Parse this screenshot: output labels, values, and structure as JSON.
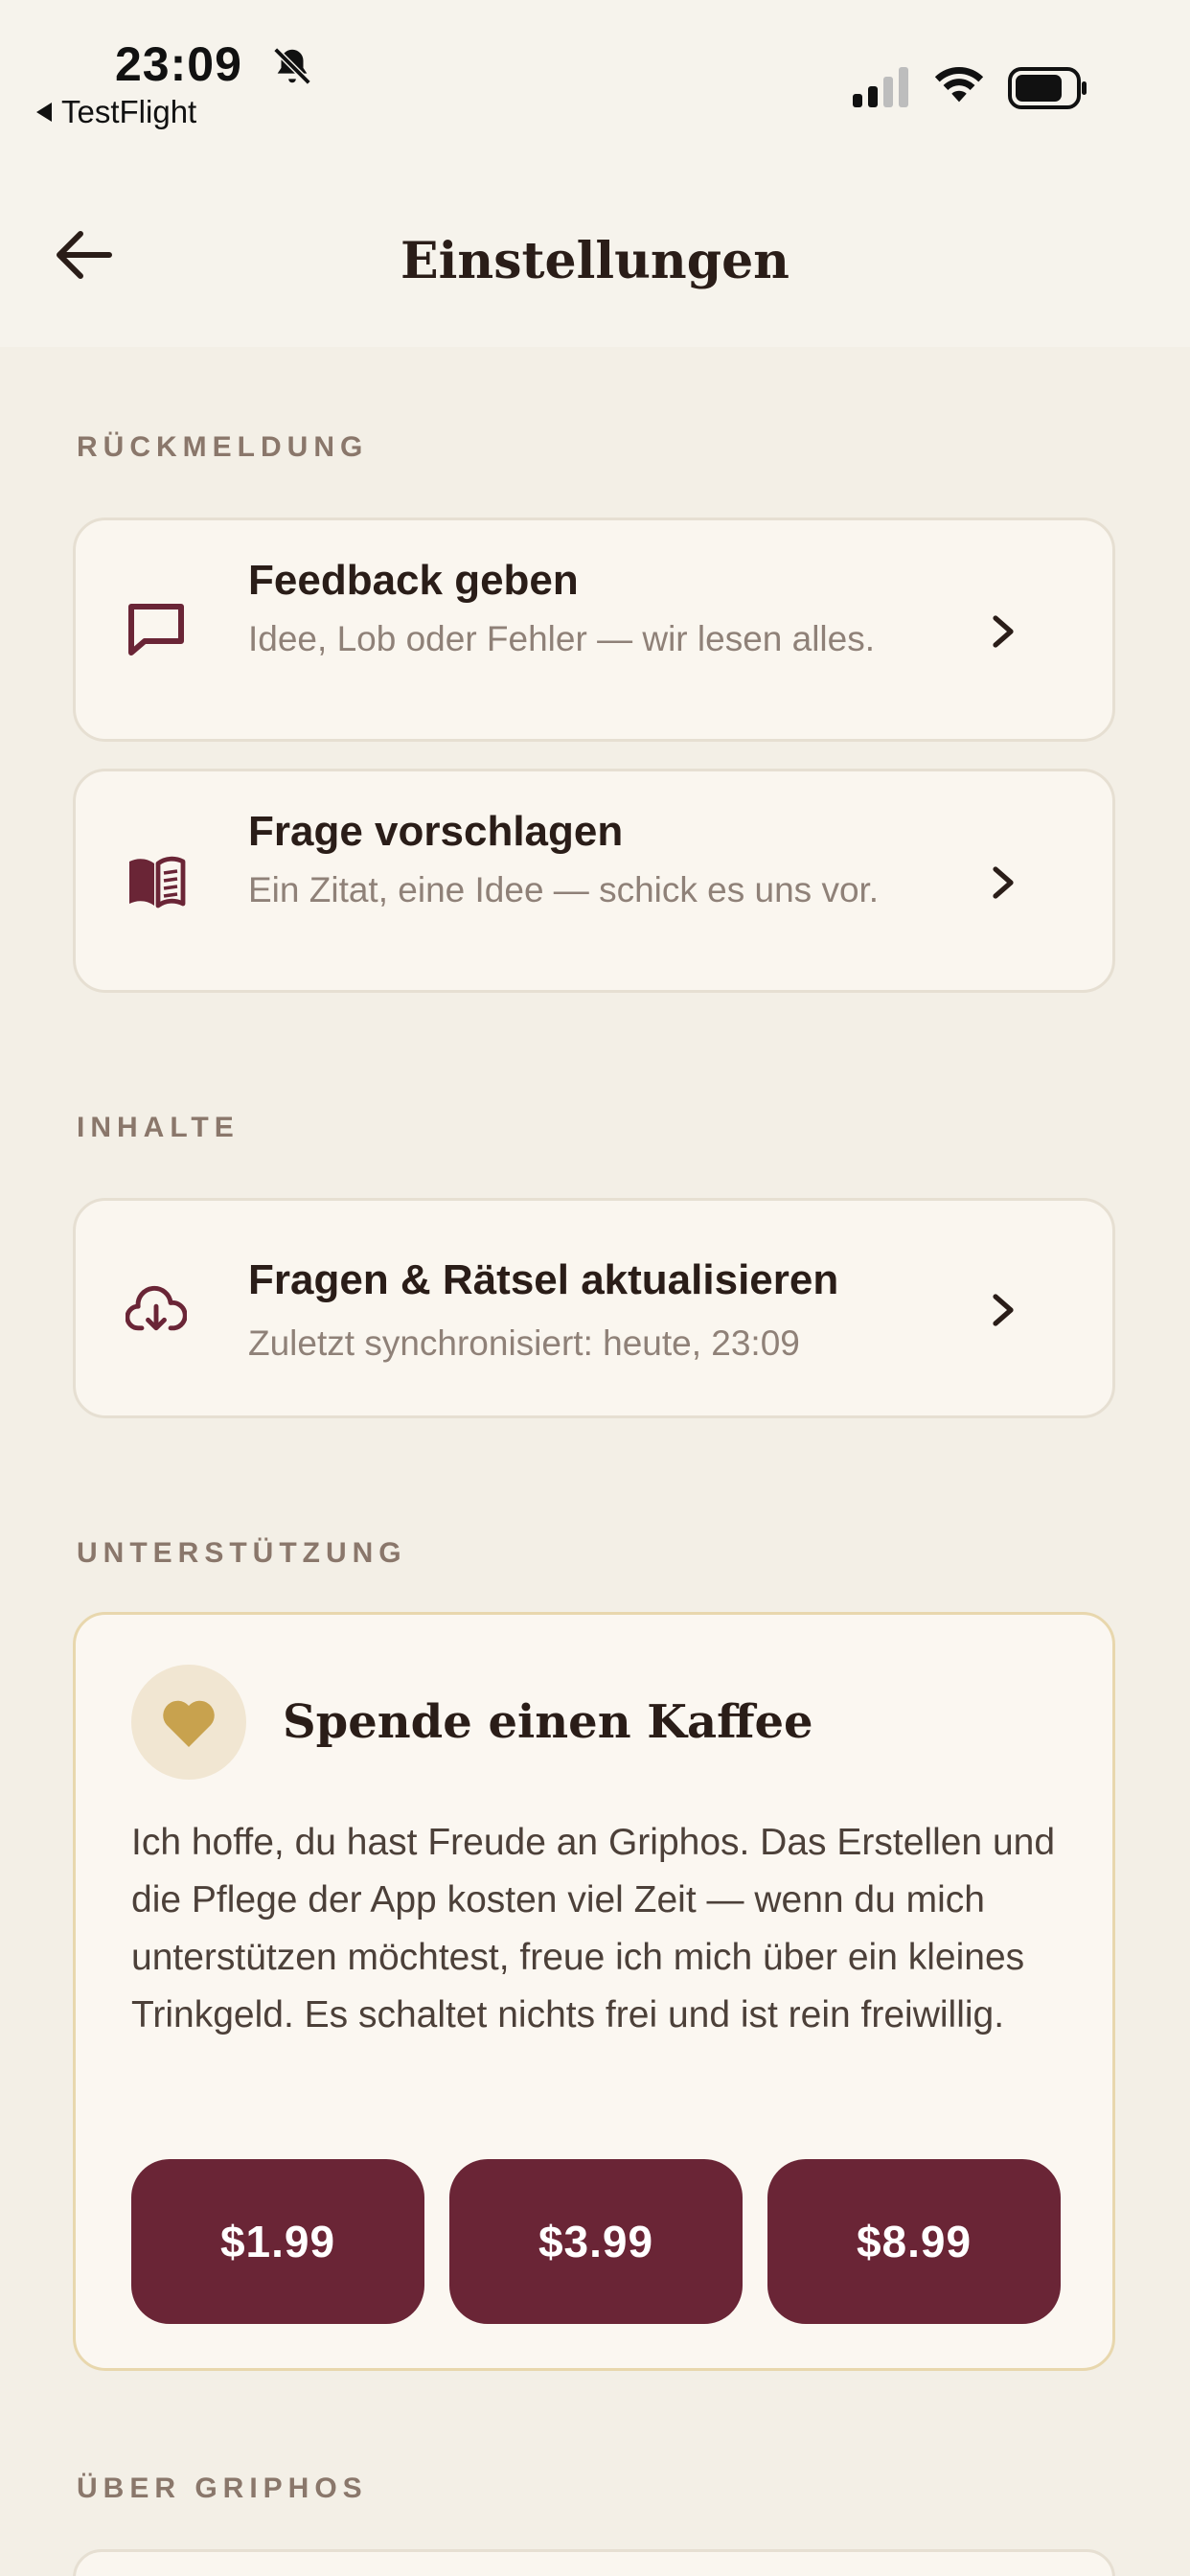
{
  "status_bar": {
    "time": "23:09",
    "back_app": "TestFlight"
  },
  "nav": {
    "title": "Einstellungen"
  },
  "sections": {
    "feedback": {
      "label": "RÜCKMELDUNG",
      "items": [
        {
          "title": "Feedback geben",
          "subtitle": "Idee, Lob oder Fehler — wir lesen alles.",
          "icon": "message-square-icon"
        },
        {
          "title": "Frage vorschlagen",
          "subtitle": "Ein Zitat, eine Idee — schick es uns vor.",
          "icon": "book-open-icon"
        }
      ]
    },
    "content": {
      "label": "INHALTE",
      "items": [
        {
          "title": "Fragen & Rätsel aktualisieren",
          "subtitle": "Zuletzt synchronisiert: heute, 23:09",
          "icon": "cloud-download-icon"
        }
      ]
    },
    "support": {
      "label": "UNTERSTÜTZUNG",
      "title": "Spende einen Kaffee",
      "text": "Ich hoffe, du hast Freude an Griphos. Das Erstellen und die Pflege der App kosten viel Zeit — wenn du mich unterstützen möchtest, freue ich mich über ein kleines Trinkgeld. Es schaltet nichts frei und ist rein freiwillig.",
      "tips": [
        "$1.99",
        "$3.99",
        "$8.99"
      ]
    },
    "about": {
      "label": "ÜBER GRIPHOS"
    }
  },
  "colors": {
    "background": "#f3efe6",
    "card": "#faf6ef",
    "accent": "#6a2536",
    "gold": "#c8a24e",
    "muted_text": "#8f8178",
    "section_label": "#8a776b"
  }
}
